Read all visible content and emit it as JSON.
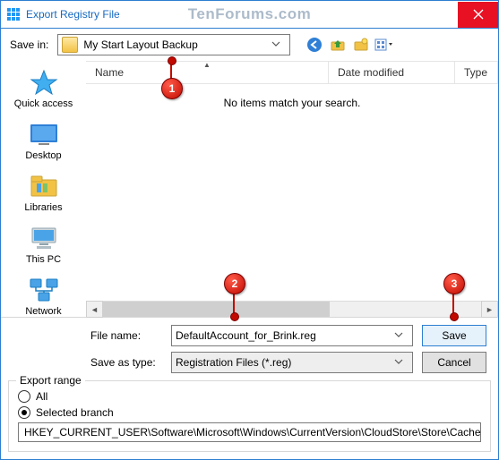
{
  "titlebar": {
    "title": "Export Registry File",
    "watermark": "TenForums.com"
  },
  "toolbar": {
    "savein_label": "Save in:",
    "savein_value": "My Start Layout Backup",
    "icons": {
      "back": "back-icon",
      "up": "up-one-level-icon",
      "newfolder": "new-folder-icon",
      "views": "views-icon"
    }
  },
  "places": [
    {
      "key": "quick-access",
      "label": "Quick access"
    },
    {
      "key": "desktop",
      "label": "Desktop"
    },
    {
      "key": "libraries",
      "label": "Libraries"
    },
    {
      "key": "this-pc",
      "label": "This PC"
    },
    {
      "key": "network",
      "label": "Network"
    }
  ],
  "columns": {
    "name": "Name",
    "date": "Date modified",
    "type": "Type"
  },
  "list": {
    "empty_message": "No items match your search."
  },
  "fields": {
    "filename_label": "File name:",
    "filename_value": "DefaultAccount_for_Brink.reg",
    "savetype_label": "Save as type:",
    "savetype_value": "Registration Files (*.reg)",
    "save_btn": "Save",
    "cancel_btn": "Cancel"
  },
  "export_range": {
    "legend": "Export range",
    "all_label": "All",
    "selected_label": "Selected branch",
    "selected_checked": true,
    "branch_path": "HKEY_CURRENT_USER\\Software\\Microsoft\\Windows\\CurrentVersion\\CloudStore\\Store\\Cache\\Def"
  },
  "annotations": {
    "m1": "1",
    "m2": "2",
    "m3": "3"
  }
}
